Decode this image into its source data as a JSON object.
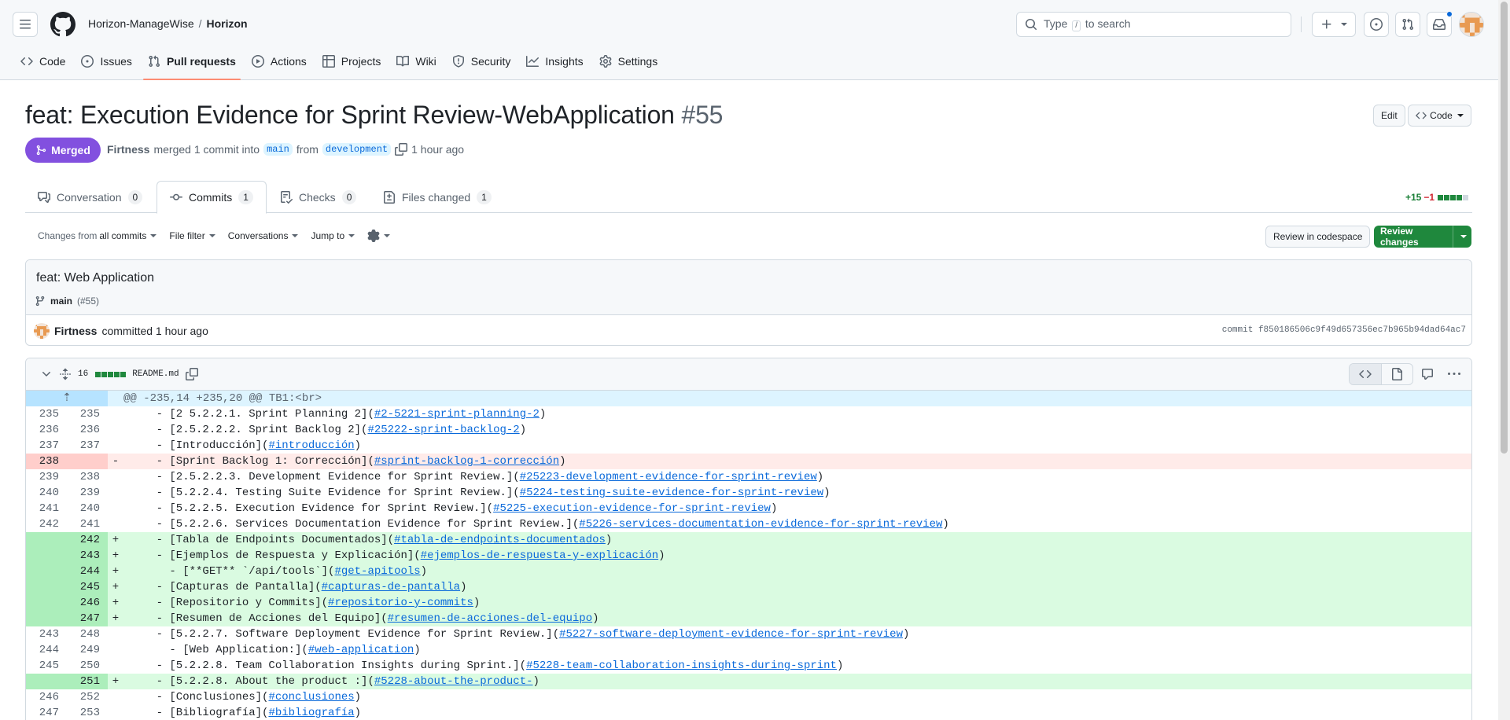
{
  "header": {
    "owner": "Horizon-ManageWise",
    "separator": "/",
    "repo": "Horizon",
    "search_prefix": "Type",
    "search_key": "/",
    "search_suffix": "to search"
  },
  "nav": {
    "code": "Code",
    "issues": "Issues",
    "pull_requests": "Pull requests",
    "actions": "Actions",
    "projects": "Projects",
    "wiki": "Wiki",
    "security": "Security",
    "insights": "Insights",
    "settings": "Settings"
  },
  "pr": {
    "title": "feat: Execution Evidence for Sprint Review-WebApplication",
    "number": "#55",
    "edit_label": "Edit",
    "code_label": "Code",
    "state": "Merged",
    "author": "Firtness",
    "merged_text": "merged 1 commit into",
    "base_branch": "main",
    "from_text": "from",
    "head_branch": "development",
    "time": "1 hour ago"
  },
  "tabs": {
    "conversation": {
      "label": "Conversation",
      "count": "0"
    },
    "commits": {
      "label": "Commits",
      "count": "1"
    },
    "checks": {
      "label": "Checks",
      "count": "0"
    },
    "files": {
      "label": "Files changed",
      "count": "1"
    }
  },
  "diffstat": {
    "additions": "+15",
    "deletions": "−1"
  },
  "toolbar": {
    "changes_from": "Changes from",
    "all_commits": "all commits",
    "file_filter": "File filter",
    "conversations": "Conversations",
    "jump_to": "Jump to",
    "review_codespace": "Review in codespace",
    "review_changes": "Review changes"
  },
  "commit": {
    "title": "feat: Web Application",
    "branch": "main",
    "pr_ref": "(#55)",
    "author": "Firtness",
    "committed": "committed 1 hour ago",
    "sha_label": "commit f850186506c9f49d657356ec7b965b94dad64ac7"
  },
  "file": {
    "changes": "16",
    "name": "README.md"
  },
  "diff_rows": [
    {
      "type": "hunk",
      "old": "",
      "new": "",
      "sign": "",
      "prefix": "@@ -235,14 +235,20 @@ TB1:<br>",
      "link": "",
      "suffix": ""
    },
    {
      "type": "ctx",
      "old": "235",
      "new": "235",
      "sign": "",
      "prefix": "    - [2 5.2.2.1. Sprint Planning 2](",
      "link": "#2-5221-sprint-planning-2",
      "suffix": ")"
    },
    {
      "type": "ctx",
      "old": "236",
      "new": "236",
      "sign": "",
      "prefix": "    - [2.5.2.2.2. Sprint Backlog 2](",
      "link": "#25222-sprint-backlog-2",
      "suffix": ")"
    },
    {
      "type": "ctx",
      "old": "237",
      "new": "237",
      "sign": "",
      "prefix": "    - [Introducción](",
      "link": "#introducción",
      "suffix": ")"
    },
    {
      "type": "del",
      "old": "238",
      "new": "",
      "sign": "-",
      "prefix": "    - [Sprint Backlog 1: Corrección](",
      "link": "#sprint-backlog-1-corrección",
      "suffix": ")"
    },
    {
      "type": "ctx",
      "old": "239",
      "new": "238",
      "sign": "",
      "prefix": "    - [2.5.2.2.3. Development Evidence for Sprint Review.](",
      "link": "#25223-development-evidence-for-sprint-review",
      "suffix": ")"
    },
    {
      "type": "ctx",
      "old": "240",
      "new": "239",
      "sign": "",
      "prefix": "    - [5.2.2.4. Testing Suite Evidence for Sprint Review.](",
      "link": "#5224-testing-suite-evidence-for-sprint-review",
      "suffix": ")"
    },
    {
      "type": "ctx",
      "old": "241",
      "new": "240",
      "sign": "",
      "prefix": "    - [5.2.2.5. Execution Evidence for Sprint Review.](",
      "link": "#5225-execution-evidence-for-sprint-review",
      "suffix": ")"
    },
    {
      "type": "ctx",
      "old": "242",
      "new": "241",
      "sign": "",
      "prefix": "    - [5.2.2.6. Services Documentation Evidence for Sprint Review.](",
      "link": "#5226-services-documentation-evidence-for-sprint-review",
      "suffix": ")"
    },
    {
      "type": "add",
      "old": "",
      "new": "242",
      "sign": "+",
      "prefix": "    - [Tabla de Endpoints Documentados](",
      "link": "#tabla-de-endpoints-documentados",
      "suffix": ")"
    },
    {
      "type": "add",
      "old": "",
      "new": "243",
      "sign": "+",
      "prefix": "    - [Ejemplos de Respuesta y Explicación](",
      "link": "#ejemplos-de-respuesta-y-explicación",
      "suffix": ")"
    },
    {
      "type": "add",
      "old": "",
      "new": "244",
      "sign": "+",
      "prefix": "      - [**GET** `/api/tools`](",
      "link": "#get-apitools",
      "suffix": ")"
    },
    {
      "type": "add",
      "old": "",
      "new": "245",
      "sign": "+",
      "prefix": "    - [Capturas de Pantalla](",
      "link": "#capturas-de-pantalla",
      "suffix": ")"
    },
    {
      "type": "add",
      "old": "",
      "new": "246",
      "sign": "+",
      "prefix": "    - [Repositorio y Commits](",
      "link": "#repositorio-y-commits",
      "suffix": ")"
    },
    {
      "type": "add",
      "old": "",
      "new": "247",
      "sign": "+",
      "prefix": "    - [Resumen de Acciones del Equipo](",
      "link": "#resumen-de-acciones-del-equipo",
      "suffix": ")"
    },
    {
      "type": "ctx",
      "old": "243",
      "new": "248",
      "sign": "",
      "prefix": "    - [5.2.2.7. Software Deployment Evidence for Sprint Review.](",
      "link": "#5227-software-deployment-evidence-for-sprint-review",
      "suffix": ")"
    },
    {
      "type": "ctx",
      "old": "244",
      "new": "249",
      "sign": "",
      "prefix": "      - [Web Application:](",
      "link": "#web-application",
      "suffix": ")"
    },
    {
      "type": "ctx",
      "old": "245",
      "new": "250",
      "sign": "",
      "prefix": "    - [5.2.2.8. Team Collaboration Insights during Sprint.](",
      "link": "#5228-team-collaboration-insights-during-sprint",
      "suffix": ")"
    },
    {
      "type": "add",
      "old": "",
      "new": "251",
      "sign": "+",
      "prefix": "    - [5.2.2.8. About the product :](",
      "link": "#5228-about-the-product-",
      "suffix": ")"
    },
    {
      "type": "ctx",
      "old": "246",
      "new": "252",
      "sign": "",
      "prefix": "    - [Conclusiones](",
      "link": "#conclusiones",
      "suffix": ")"
    },
    {
      "type": "ctx",
      "old": "247",
      "new": "253",
      "sign": "",
      "prefix": "    - [Bibliografía](",
      "link": "#bibliografía",
      "suffix": ")"
    }
  ],
  "colors": {
    "merged": "#8250df",
    "primary_button": "#1f883d",
    "link": "#0969da",
    "add_bg": "#dafbe1",
    "del_bg": "#ffebe9",
    "hunk_bg": "#ddf4ff"
  }
}
